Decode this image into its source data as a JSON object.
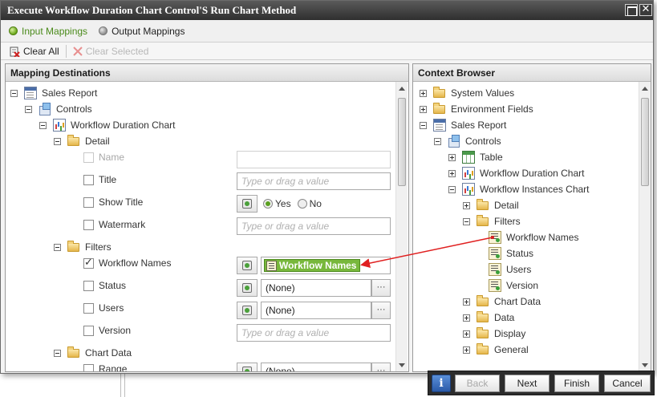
{
  "window": {
    "title": "Execute Workflow Duration Chart Control'S Run Chart Method",
    "close_glyph": "✕"
  },
  "tabs": [
    {
      "label": "Input Mappings",
      "active": true
    },
    {
      "label": "Output Mappings",
      "active": false
    }
  ],
  "toolbar": {
    "clear_all": "Clear All",
    "clear_selected": "Clear Selected"
  },
  "left_panel": {
    "header": "Mapping Destinations",
    "tree": {
      "sales_report": "Sales Report",
      "controls": "Controls",
      "workflow_duration_chart": "Workflow Duration Chart",
      "detail": "Detail",
      "filters": "Filters",
      "chart_data": "Chart Data"
    },
    "fields": {
      "name": {
        "label": "Name",
        "placeholder": ""
      },
      "title": {
        "label": "Title",
        "placeholder": "Type or drag a value"
      },
      "show_title": {
        "label": "Show Title",
        "yes": "Yes",
        "no": "No",
        "selected": "Yes"
      },
      "watermark": {
        "label": "Watermark",
        "placeholder": "Type or drag a value"
      },
      "workflow_names": {
        "label": "Workflow Names",
        "value": "Workflow Names",
        "checked": true
      },
      "status": {
        "label": "Status",
        "value": "(None)"
      },
      "users": {
        "label": "Users",
        "value": "(None)"
      },
      "version": {
        "label": "Version",
        "placeholder": "Type or drag a value"
      },
      "range": {
        "label": "Range",
        "value": "(None)"
      }
    },
    "ellipsis": "···"
  },
  "right_panel": {
    "header": "Context Browser",
    "tree": {
      "system_values": "System Values",
      "environment_fields": "Environment Fields",
      "sales_report": "Sales Report",
      "controls": "Controls",
      "table": "Table",
      "workflow_duration_chart": "Workflow Duration Chart",
      "workflow_instances_chart": "Workflow Instances Chart",
      "detail": "Detail",
      "filters": "Filters",
      "workflow_names": "Workflow Names",
      "status": "Status",
      "users": "Users",
      "version": "Version",
      "chart_data": "Chart Data",
      "data": "Data",
      "display": "Display",
      "general": "General"
    }
  },
  "footer": {
    "info": "i",
    "back": "Back",
    "next": "Next",
    "finish": "Finish",
    "cancel": "Cancel"
  },
  "colors": {
    "accent_green": "#78b83c",
    "arrow_red": "#e02020",
    "title_bar": "#3a3a3a"
  }
}
